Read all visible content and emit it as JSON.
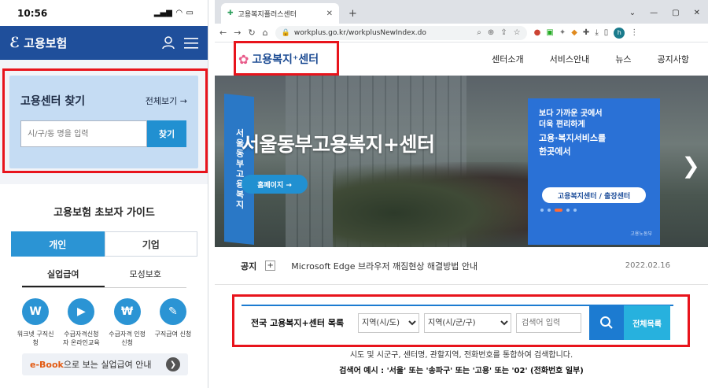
{
  "mobile": {
    "status": {
      "time": "10:56"
    },
    "header": {
      "logo_text": "고용보험"
    },
    "find_center": {
      "title": "고용센터 찾기",
      "view_all": "전체보기 →",
      "search_placeholder": "시/구/동 명을 입력",
      "search_button": "찾기"
    },
    "guide": {
      "title": "고용보험 초보자 가이드",
      "tabs": [
        "개인",
        "기업"
      ],
      "subtabs": [
        "실업급여",
        "모성보호"
      ],
      "items": [
        {
          "icon": "W",
          "label": "워크넷 구직신청"
        },
        {
          "icon": "▶",
          "label": "수급자격신청자 온라인교육"
        },
        {
          "icon": "₩",
          "label": "수급자격 인정신청"
        },
        {
          "icon": "✎",
          "label": "구직급여 신청"
        }
      ],
      "ebook_highlight": "e-Book",
      "ebook_rest": "으로 보는 실업급여 안내"
    }
  },
  "browser": {
    "tab_title": "고용복지플러스센터",
    "url": "workplus.go.kr/workplusNewIndex.do",
    "profile_initial": "h",
    "site": {
      "logo_text": "고용복지⁺센터",
      "menu": [
        "센터소개",
        "서비스안내",
        "뉴스",
        "공지사항"
      ]
    },
    "hero": {
      "banner_text": "서울동부고용복지",
      "title": "서울동부고용복지+센터",
      "home_button": "홈페이지 →",
      "promo_line1": "보다 가까운 곳에서",
      "promo_line2": "더욱 편리하게",
      "promo_line3": "고용·복지서비스를",
      "promo_line4": "한곳에서",
      "promo_button": "고용복지센터 / 출장센터",
      "promo_seal": "고용노동부"
    },
    "notice": {
      "label": "공지",
      "text": "Microsoft Edge 브라우저 깨짐현상 해결방법 안내",
      "date": "2022.02.16"
    },
    "search": {
      "label": "전국 고용복지+센터 목록",
      "region1": "지역(시/도)",
      "region2": "지역(시/군/구)",
      "placeholder": "검색어 입력",
      "all_button": "전체목록"
    },
    "hint1": "시도 및 시군구, 센터명, 관할지역, 전화번호를 통합하여 검색합니다.",
    "hint2": "검색어 예시 : '서울' 또는 '송파구' 또는 '고용' 또는 '02' (전화번호 일부)"
  }
}
